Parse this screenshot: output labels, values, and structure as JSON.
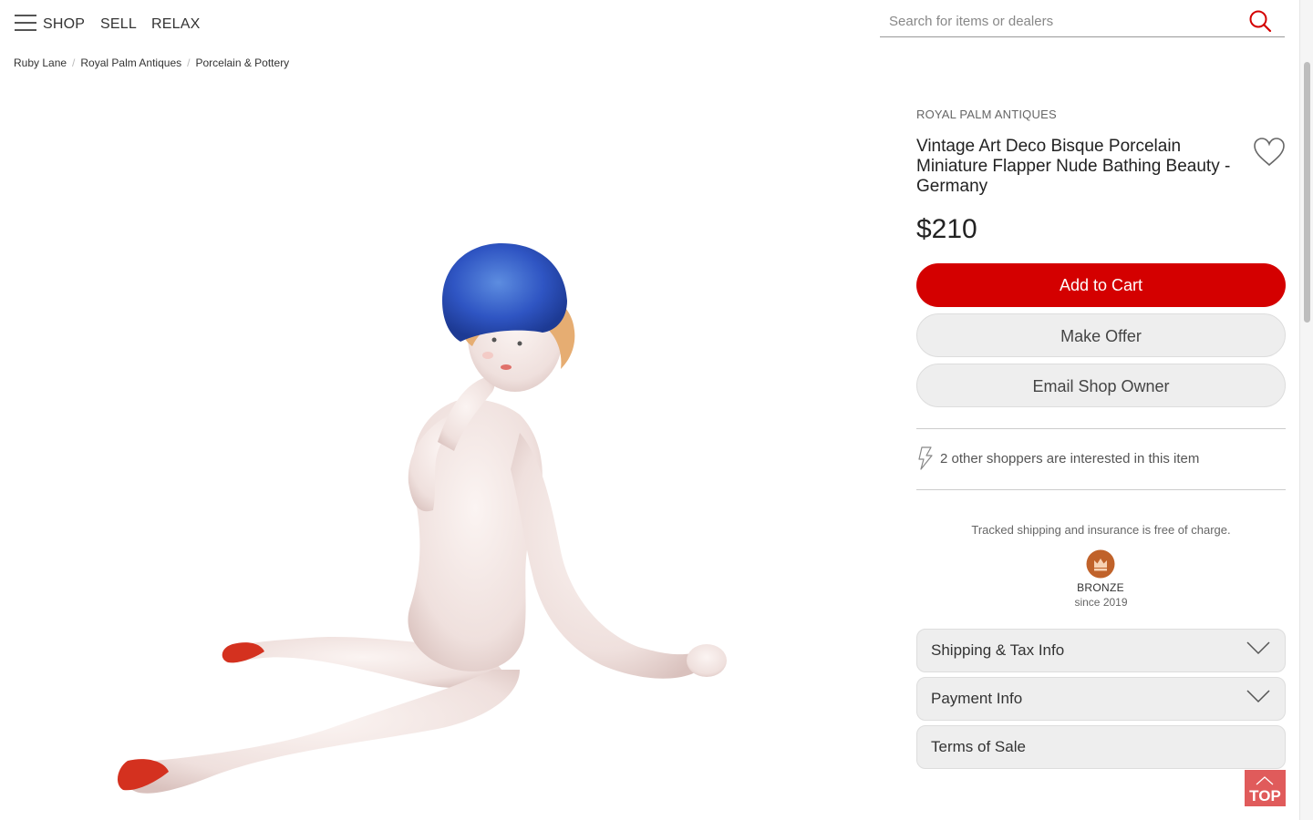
{
  "header": {
    "nav": [
      "SHOP",
      "SELL",
      "RELAX"
    ],
    "search_placeholder": "Search for items or dealers"
  },
  "breadcrumb": [
    "Ruby Lane",
    "Royal Palm Antiques",
    "Porcelain & Pottery"
  ],
  "product": {
    "shop_name": "ROYAL PALM ANTIQUES",
    "title": "Vintage Art Deco Bisque Porcelain Miniature Flapper Nude Bathing Beauty - Germany",
    "price": "$210",
    "image_icon": "porcelain-figurine-image"
  },
  "actions": {
    "add_to_cart": "Add to Cart",
    "make_offer": "Make Offer",
    "email_owner": "Email Shop Owner"
  },
  "interest": {
    "icon": "lightning-bolt-icon",
    "text": "2 other shoppers are interested in this item"
  },
  "shipping_note": "Tracked shipping and insurance is free of charge.",
  "badge": {
    "icon": "crown-icon",
    "level": "BRONZE",
    "since": "since 2019"
  },
  "accordions": [
    {
      "label": "Shipping & Tax Info",
      "expandable": true
    },
    {
      "label": "Payment Info",
      "expandable": true
    },
    {
      "label": "Terms of Sale",
      "expandable": false
    }
  ],
  "top_button": "TOP",
  "colors": {
    "accent": "#d40000",
    "top_button": "#e05b5b",
    "badge_bronze": "#c0622a"
  }
}
